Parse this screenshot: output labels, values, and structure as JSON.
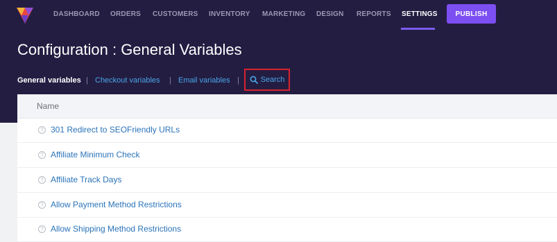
{
  "nav": {
    "items": [
      {
        "label": "DASHBOARD",
        "active": false
      },
      {
        "label": "ORDERS",
        "active": false
      },
      {
        "label": "CUSTOMERS",
        "active": false
      },
      {
        "label": "INVENTORY",
        "active": false
      },
      {
        "label": "MARKETING",
        "active": false
      },
      {
        "label": "DESIGN",
        "active": false
      },
      {
        "label": "REPORTS",
        "active": false
      },
      {
        "label": "SETTINGS",
        "active": true
      }
    ],
    "publish_label": "PUBLISH"
  },
  "page": {
    "title": "Configuration : General Variables"
  },
  "subnav": {
    "items": [
      {
        "label": "General variables",
        "active": true
      },
      {
        "label": "Checkout variables",
        "active": false
      },
      {
        "label": "Email variables",
        "active": false
      }
    ],
    "search_label": "Search"
  },
  "table": {
    "header": "Name",
    "rows": [
      "301 Redirect to SEOFriendly URLs",
      "Affiliate Minimum Check",
      "Affiliate Track Days",
      "Allow Payment Method Restrictions",
      "Allow Shipping Method Restrictions"
    ]
  },
  "colors": {
    "header_bg": "#241d42",
    "accent": "#7c4ff2",
    "link": "#48a6e8",
    "highlight_border": "#d9232f"
  }
}
